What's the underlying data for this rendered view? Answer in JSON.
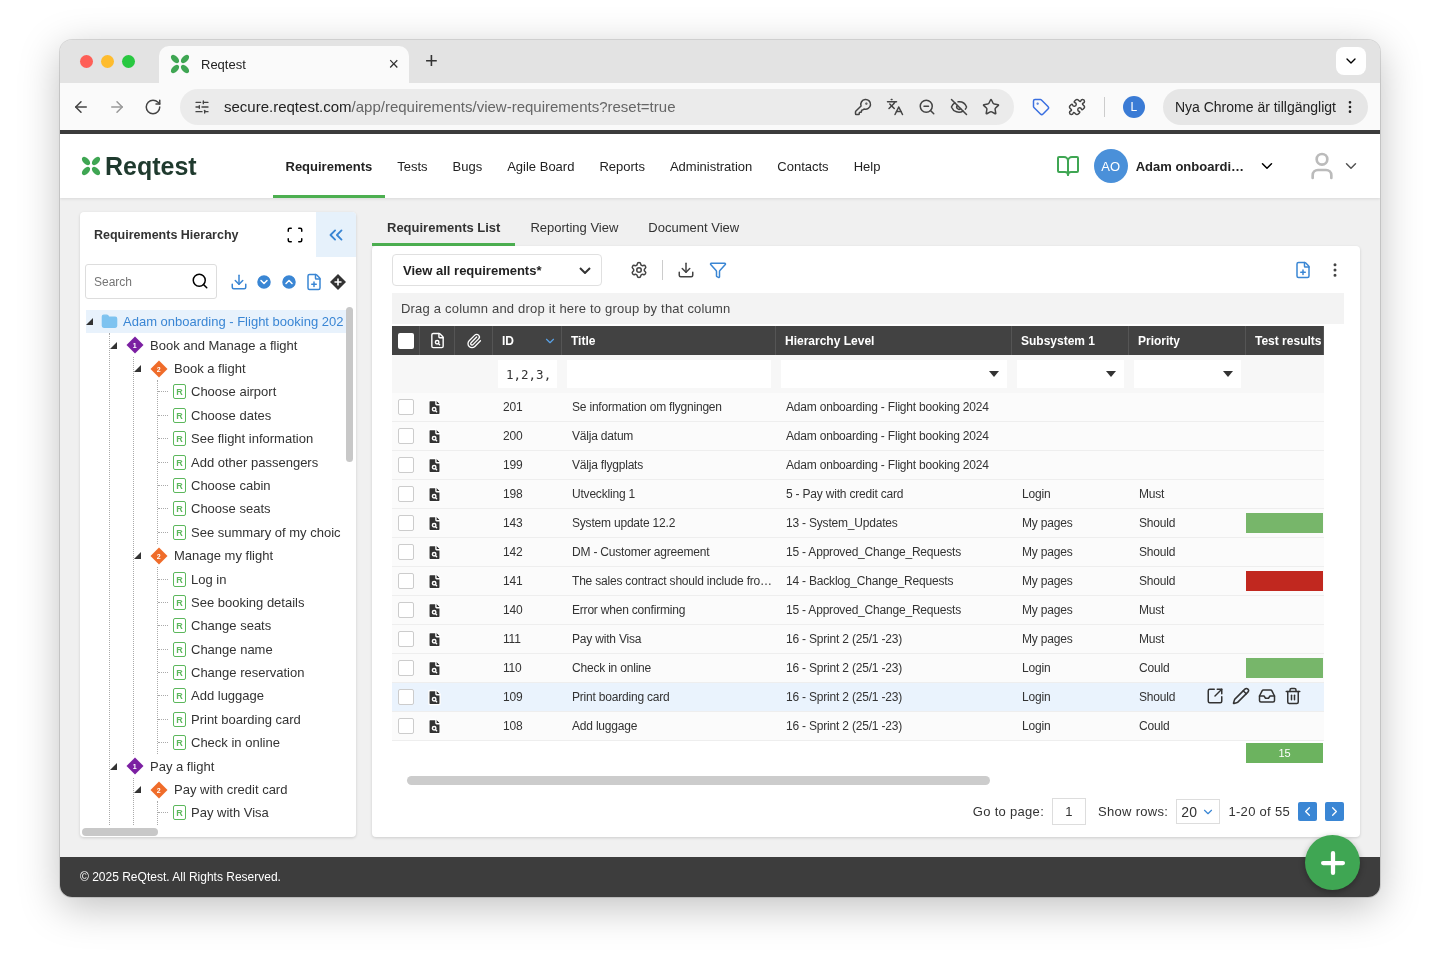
{
  "browser": {
    "tab_title": "Reqtest",
    "tab_close": "×",
    "new_tab": "+",
    "url_host": "secure.reqtest.com",
    "url_path": "/app/requirements/view-requirements?reset=true",
    "profile_initial": "L",
    "update_button": "Nya Chrome är tillgängligt"
  },
  "header": {
    "logo": "Reqtest",
    "nav": [
      {
        "label": "Requirements",
        "selected": true
      },
      {
        "label": "Tests",
        "selected": false
      },
      {
        "label": "Bugs",
        "selected": false
      },
      {
        "label": "Agile Board",
        "selected": false
      },
      {
        "label": "Reports",
        "selected": false
      },
      {
        "label": "Administration",
        "selected": false
      },
      {
        "label": "Contacts",
        "selected": false
      },
      {
        "label": "Help",
        "selected": false
      }
    ],
    "user_initials": "AO",
    "user_name": "Adam onboardi…"
  },
  "hierarchy": {
    "title": "Requirements Hierarchy",
    "search_placeholder": "Search",
    "tree": [
      {
        "kind": "folder",
        "label": "Adam onboarding - Flight booking 202",
        "selected": true,
        "expanded": true,
        "children": [
          {
            "kind": "group",
            "badge": "1",
            "color": "#7b1fa2",
            "label": "Book and Manage a flight",
            "selected": false,
            "expanded": true,
            "children": [
              {
                "kind": "group",
                "badge": "2",
                "color": "#ef6c2a",
                "label": "Book a flight",
                "selected": false,
                "expanded": true,
                "children": [
                  {
                    "kind": "requirement",
                    "icon_text": "R",
                    "label": "Choose airport",
                    "selected": false
                  },
                  {
                    "kind": "requirement",
                    "icon_text": "R",
                    "label": "Choose dates",
                    "selected": false
                  },
                  {
                    "kind": "requirement",
                    "icon_text": "R",
                    "label": "See flight information",
                    "selected": false
                  },
                  {
                    "kind": "requirement",
                    "icon_text": "R",
                    "label": "Add other passengers",
                    "selected": false
                  },
                  {
                    "kind": "requirement",
                    "icon_text": "R",
                    "label": "Choose cabin",
                    "selected": false
                  },
                  {
                    "kind": "requirement",
                    "icon_text": "R",
                    "label": "Choose seats",
                    "selected": false
                  },
                  {
                    "kind": "requirement",
                    "icon_text": "R",
                    "label": "See summary of my choic",
                    "selected": false
                  }
                ]
              },
              {
                "kind": "group",
                "badge": "2",
                "color": "#ef6c2a",
                "label": "Manage my flight",
                "selected": false,
                "expanded": true,
                "children": [
                  {
                    "kind": "requirement",
                    "icon_text": "R",
                    "label": "Log in",
                    "selected": false
                  },
                  {
                    "kind": "requirement",
                    "icon_text": "R",
                    "label": "See booking details",
                    "selected": false
                  },
                  {
                    "kind": "requirement",
                    "icon_text": "R",
                    "label": "Change seats",
                    "selected": false
                  },
                  {
                    "kind": "requirement",
                    "icon_text": "R",
                    "label": "Change name",
                    "selected": false
                  },
                  {
                    "kind": "requirement",
                    "icon_text": "R",
                    "label": "Change reservation",
                    "selected": false
                  },
                  {
                    "kind": "requirement",
                    "icon_text": "R",
                    "label": "Add luggage",
                    "selected": false
                  },
                  {
                    "kind": "requirement",
                    "icon_text": "R",
                    "label": "Print boarding card",
                    "selected": false
                  },
                  {
                    "kind": "requirement",
                    "icon_text": "R",
                    "label": "Check in online",
                    "selected": false
                  }
                ]
              }
            ]
          },
          {
            "kind": "group",
            "badge": "1",
            "color": "#7b1fa2",
            "label": "Pay a flight",
            "selected": false,
            "expanded": true,
            "children": [
              {
                "kind": "group",
                "badge": "2",
                "color": "#ef6c2a",
                "label": "Pay with credit card",
                "selected": false,
                "expanded": true,
                "children": [
                  {
                    "kind": "requirement",
                    "icon_text": "R",
                    "label": "Pay with Visa",
                    "selected": false
                  }
                ]
              }
            ]
          }
        ]
      }
    ]
  },
  "views": {
    "tabs": [
      {
        "label": "Requirements List",
        "selected": true
      },
      {
        "label": "Reporting View",
        "selected": false
      },
      {
        "label": "Document View",
        "selected": false
      }
    ],
    "view_select": "View all requirements*",
    "group_hint": "Drag a column and drop it here to group by that column",
    "select_all_checked": false,
    "columns": [
      "ID",
      "Title",
      "Hierarchy Level",
      "Subsystem 1",
      "Priority",
      "Test results"
    ],
    "id_filter": "1,2,3,",
    "rows": [
      {
        "id": "201",
        "title": "Se information om flygningen",
        "hierarchy": "Adam onboarding - Flight booking 2024",
        "subsystem": "",
        "priority": "",
        "checked": false,
        "selected": false
      },
      {
        "id": "200",
        "title": "Välja datum",
        "hierarchy": "Adam onboarding - Flight booking 2024",
        "subsystem": "",
        "priority": "",
        "checked": false,
        "selected": false
      },
      {
        "id": "199",
        "title": "Välja flygplats",
        "hierarchy": "Adam onboarding - Flight booking 2024",
        "subsystem": "",
        "priority": "",
        "checked": false,
        "selected": false
      },
      {
        "id": "198",
        "title": "Utveckling 1",
        "hierarchy": "5 - Pay with credit card",
        "subsystem": "Login",
        "priority": "Must",
        "checked": false,
        "selected": false
      },
      {
        "id": "143",
        "title": "System update 12.2",
        "hierarchy": "13 - System_Updates",
        "subsystem": "My pages",
        "priority": "Should",
        "color": "#77b66a",
        "checked": false,
        "selected": false
      },
      {
        "id": "142",
        "title": "DM - Customer agreement",
        "hierarchy": "15 - Approved_Change_Requests",
        "subsystem": "My pages",
        "priority": "Should",
        "checked": false,
        "selected": false
      },
      {
        "id": "141",
        "title": "The sales contract should include fro…",
        "hierarchy": "14 - Backlog_Change_Requests",
        "subsystem": "My pages",
        "priority": "Should",
        "color": "#c1281f",
        "checked": false,
        "selected": false
      },
      {
        "id": "140",
        "title": "Error when confirming",
        "hierarchy": "15 - Approved_Change_Requests",
        "subsystem": "My pages",
        "priority": "Must",
        "checked": false,
        "selected": false
      },
      {
        "id": "111",
        "title": "Pay with Visa",
        "hierarchy": "16 - Sprint 2 (25/1 -23)",
        "subsystem": "My pages",
        "priority": "Must",
        "checked": false,
        "selected": false
      },
      {
        "id": "110",
        "title": "Check in online",
        "hierarchy": "16 - Sprint 2 (25/1 -23)",
        "subsystem": "Login",
        "priority": "Could",
        "color": "#77b66a",
        "checked": false,
        "selected": false
      },
      {
        "id": "109",
        "title": "Print boarding card",
        "hierarchy": "16 - Sprint 2 (25/1 -23)",
        "subsystem": "Login",
        "priority": "Should",
        "checked": false,
        "selected": true
      },
      {
        "id": "108",
        "title": "Add luggage",
        "hierarchy": "16 - Sprint 2 (25/1 -23)",
        "subsystem": "Login",
        "priority": "Could",
        "checked": false,
        "selected": false
      }
    ],
    "summary_test_results": "15",
    "pagination": {
      "go_to_label": "Go to page:",
      "page": "1",
      "show_rows_label": "Show rows:",
      "rows_per_page": "20",
      "range": "1-20 of 55"
    }
  },
  "footer": "© 2025 ReQtest. All Rights Reserved."
}
